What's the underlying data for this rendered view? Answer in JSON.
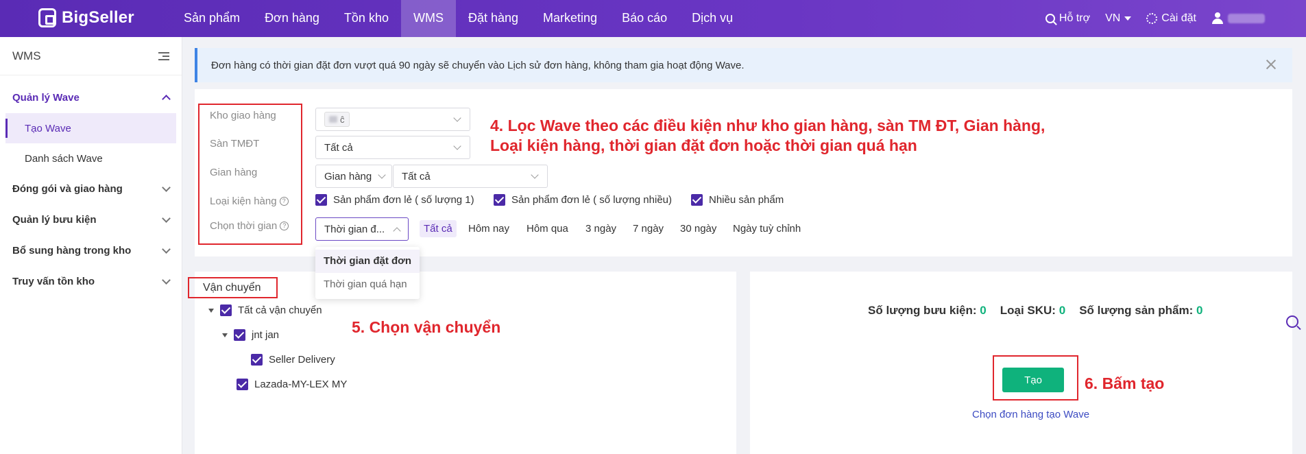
{
  "app": {
    "brand": "BigSeller"
  },
  "nav": {
    "items": [
      "Sản phẩm",
      "Đơn hàng",
      "Tồn kho",
      "WMS",
      "Đặt hàng",
      "Marketing",
      "Báo cáo",
      "Dịch vụ"
    ],
    "active_index": 3
  },
  "topright": {
    "support": "Hỗ trợ",
    "lang": "VN",
    "settings": "Cài đặt"
  },
  "sidebar": {
    "title": "WMS",
    "group_wave": "Quản lý Wave",
    "item_create": "Tạo Wave",
    "item_list": "Danh sách Wave",
    "groups": [
      "Đóng gói và giao hàng",
      "Quản lý bưu kiện",
      "Bổ sung hàng trong kho",
      "Truy vấn tồn kho"
    ]
  },
  "alert": {
    "text": "Đơn hàng có thời gian đặt đơn vượt quá 90 ngày sẽ chuyển vào Lịch sử đơn hàng, không tham gia hoạt động Wave."
  },
  "filters": {
    "warehouse_label": "Kho giao hàng",
    "marketplace_label": "Sàn TMĐT",
    "store_label": "Gian hàng",
    "package_type_label": "Loại kiện hàng",
    "time_label": "Chọn thời gian",
    "warehouse_chip": "ĉ",
    "marketplace_value": "Tất cả",
    "store_type_value": "Gian hàng",
    "store_value": "Tất cả",
    "package_types": [
      "Sản phẩm đơn lẻ ( số lượng 1)",
      "Sản phẩm đơn lẻ ( số lượng nhiều)",
      "Nhiều sản phẩm"
    ],
    "time_type_value": "Thời gian đ...",
    "time_options": [
      "Tất cả",
      "Hôm nay",
      "Hôm qua",
      "3 ngày",
      "7 ngày",
      "30 ngày",
      "Ngày tuỳ chỉnh"
    ],
    "time_dropdown": [
      "Thời gian đặt đơn",
      "Thời gian quá hạn"
    ]
  },
  "annotations": {
    "step4_line1": "4. Lọc Wave theo các điều kiện như kho gian hàng, sàn TM ĐT, Gian hàng,",
    "step4_line2": "Loại kiện hàng, thời gian đặt đơn hoặc thời gian quá hạn",
    "step5": "5. Chọn vận chuyển",
    "step6": "6. Bấm tạo"
  },
  "shipping": {
    "title": "Vận chuyển",
    "all": "Tất cả vận chuyển",
    "tree": [
      {
        "name": "jnt jan",
        "children": [
          "Seller Delivery"
        ]
      },
      {
        "name": "Lazada-MY-LEX MY",
        "children": []
      }
    ]
  },
  "stats": {
    "parcels_label": "Số lượng bưu kiện:",
    "parcels": "0",
    "sku_label": "Loại SKU:",
    "sku": "0",
    "products_label": "Số lượng sản phẩm:",
    "products": "0"
  },
  "actions": {
    "create": "Tạo",
    "choose_orders": "Chọn đơn hàng tạo Wave"
  },
  "colors": {
    "brand": "#5a2bb5",
    "accent_green": "#0fb27c",
    "annotation_red": "#e0262d"
  }
}
